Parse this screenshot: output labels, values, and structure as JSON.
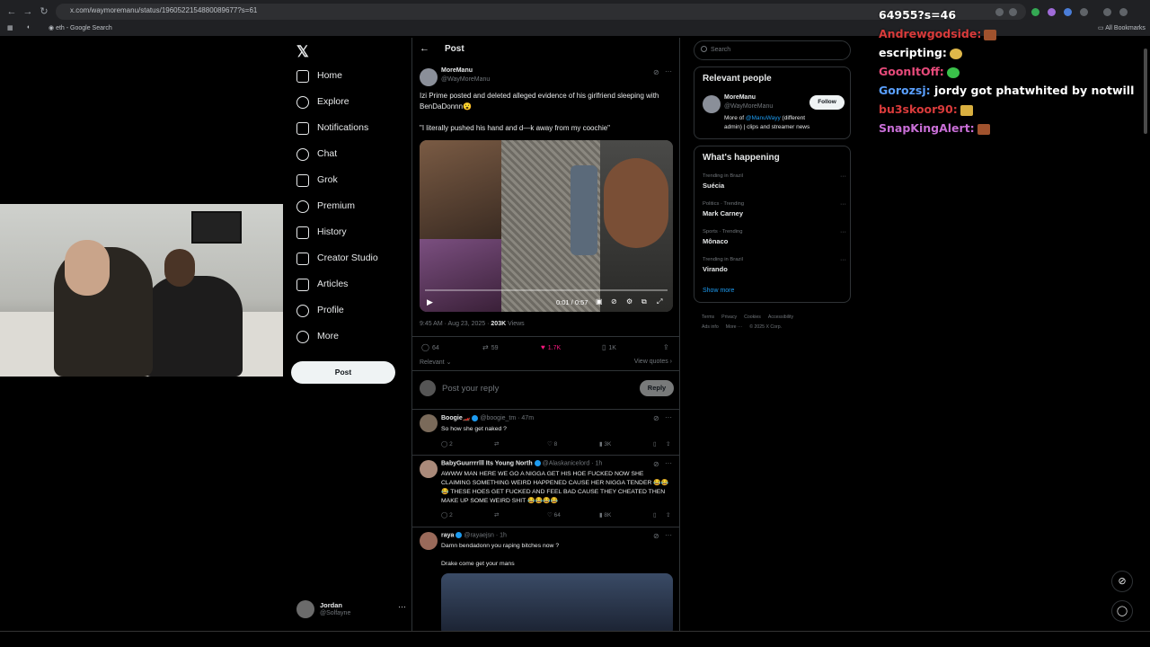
{
  "browser": {
    "url": "x.com/waymoremanu/status/1960522154880089677?s=61",
    "url_host": "x.com",
    "bookmarks": [
      {
        "label": "eth - Google Search"
      },
      {
        "label": "All Bookmarks"
      }
    ]
  },
  "chat": [
    {
      "user": "64955?s=46",
      "message": "",
      "color": "#ffffff"
    },
    {
      "user": "Andrewgodside:",
      "message": "",
      "color": "#d93b3b"
    },
    {
      "user": "escripting:",
      "message": "",
      "color": "#ffffff"
    },
    {
      "user": "GoonItOff:",
      "message": "",
      "color": "#e64a7a"
    },
    {
      "user": "Gorozsj:",
      "message": "jordy got phatwhited by notwill",
      "color": "#5aa0ff"
    },
    {
      "user": "bu3skoor90:",
      "message": "",
      "color": "#d93b3b"
    },
    {
      "user": "SnapKingAlert:",
      "message": "",
      "color": "#c86ed6"
    }
  ],
  "nav": {
    "items": [
      {
        "label": "Home",
        "icon": "home-icon"
      },
      {
        "label": "Explore",
        "icon": "search-icon"
      },
      {
        "label": "Notifications",
        "icon": "bell-icon"
      },
      {
        "label": "Chat",
        "icon": "chat-icon"
      },
      {
        "label": "Grok",
        "icon": "grok-icon"
      },
      {
        "label": "Premium",
        "icon": "premium-icon"
      },
      {
        "label": "History",
        "icon": "bookmark-icon"
      },
      {
        "label": "Creator Studio",
        "icon": "creator-studio-icon"
      },
      {
        "label": "Articles",
        "icon": "articles-icon"
      },
      {
        "label": "Profile",
        "icon": "profile-icon"
      },
      {
        "label": "More",
        "icon": "more-icon"
      }
    ],
    "post_label": "Post",
    "account": {
      "name": "Jordan",
      "handle": "@Solfayne"
    }
  },
  "post": {
    "header_title": "Post",
    "author_name": "MoreManu",
    "author_handle": "@WayMoreManu",
    "text_1": "Izi Prime posted and deleted alleged evidence of his girlfriend sleeping with BenDaDonnn😮",
    "text_2": "\"I literally pushed his hand and d—k away from my coochie\"",
    "video_time": "0:01 / 0:57",
    "timestamp": "9:45 AM · Aug 23, 2025 ·",
    "views_count": "203K",
    "views_label": "Views",
    "replies": "64",
    "reposts": "59",
    "likes": "1.7K",
    "bookmarks": "1K",
    "sort_label": "Relevant",
    "view_quotes": "View quotes",
    "reply_placeholder": "Post your reply",
    "reply_button": "Reply"
  },
  "replies": [
    {
      "name": "Boogie🏎️",
      "handle": "@boogie_tm · 47m",
      "text": "So how she get naked ?",
      "replies": "2",
      "reposts": "",
      "likes": "8",
      "views": "3K"
    },
    {
      "name": "BabyGuurrrrlll Its Young North",
      "handle": "@Alaskanicelord · 1h",
      "text": "AWWW MAN HERE WE GO A NIGGA GET HIS HOE FUCKED NOW SHE CLAIMING SOMETHING WEIRD HAPPENED CAUSE HER NIGGA TENDER 😂😂😂 THESE HOES GET FUCKED AND FEEL BAD CAUSE THEY CHEATED THEN MAKE UP SOME WEIRD SHIT 😂😂😂😂",
      "replies": "2",
      "reposts": "",
      "likes": "64",
      "views": "8K"
    },
    {
      "name": "raya",
      "handle": "@rayaejsn · 1h",
      "text": "Damn bendadonn you raping bitches now ?",
      "text_2": "Drake come get your mans"
    }
  ],
  "right": {
    "search_placeholder": "Search",
    "relevant_title": "Relevant people",
    "person": {
      "name": "MoreManu",
      "handle": "@WayMoreManu",
      "bio_pre": "More of",
      "bio_link": "@ManuWayy",
      "bio_post": "(different admin) | clips and streamer news",
      "follow_label": "Follow"
    },
    "happening_title": "What's happening",
    "trends": [
      {
        "context": "Trending in Brazil",
        "name": "Suécia"
      },
      {
        "context": "Politics · Trending",
        "name": "Mark Carney"
      },
      {
        "context": "Sports · Trending",
        "name": "Mônaco"
      },
      {
        "context": "Trending in Brazil",
        "name": "Virando"
      }
    ],
    "show_more": "Show more",
    "footer": [
      "Terms",
      "Privacy",
      "Cookies",
      "Accessibility",
      "Ads info",
      "More ···",
      "© 2025 X Corp."
    ]
  }
}
